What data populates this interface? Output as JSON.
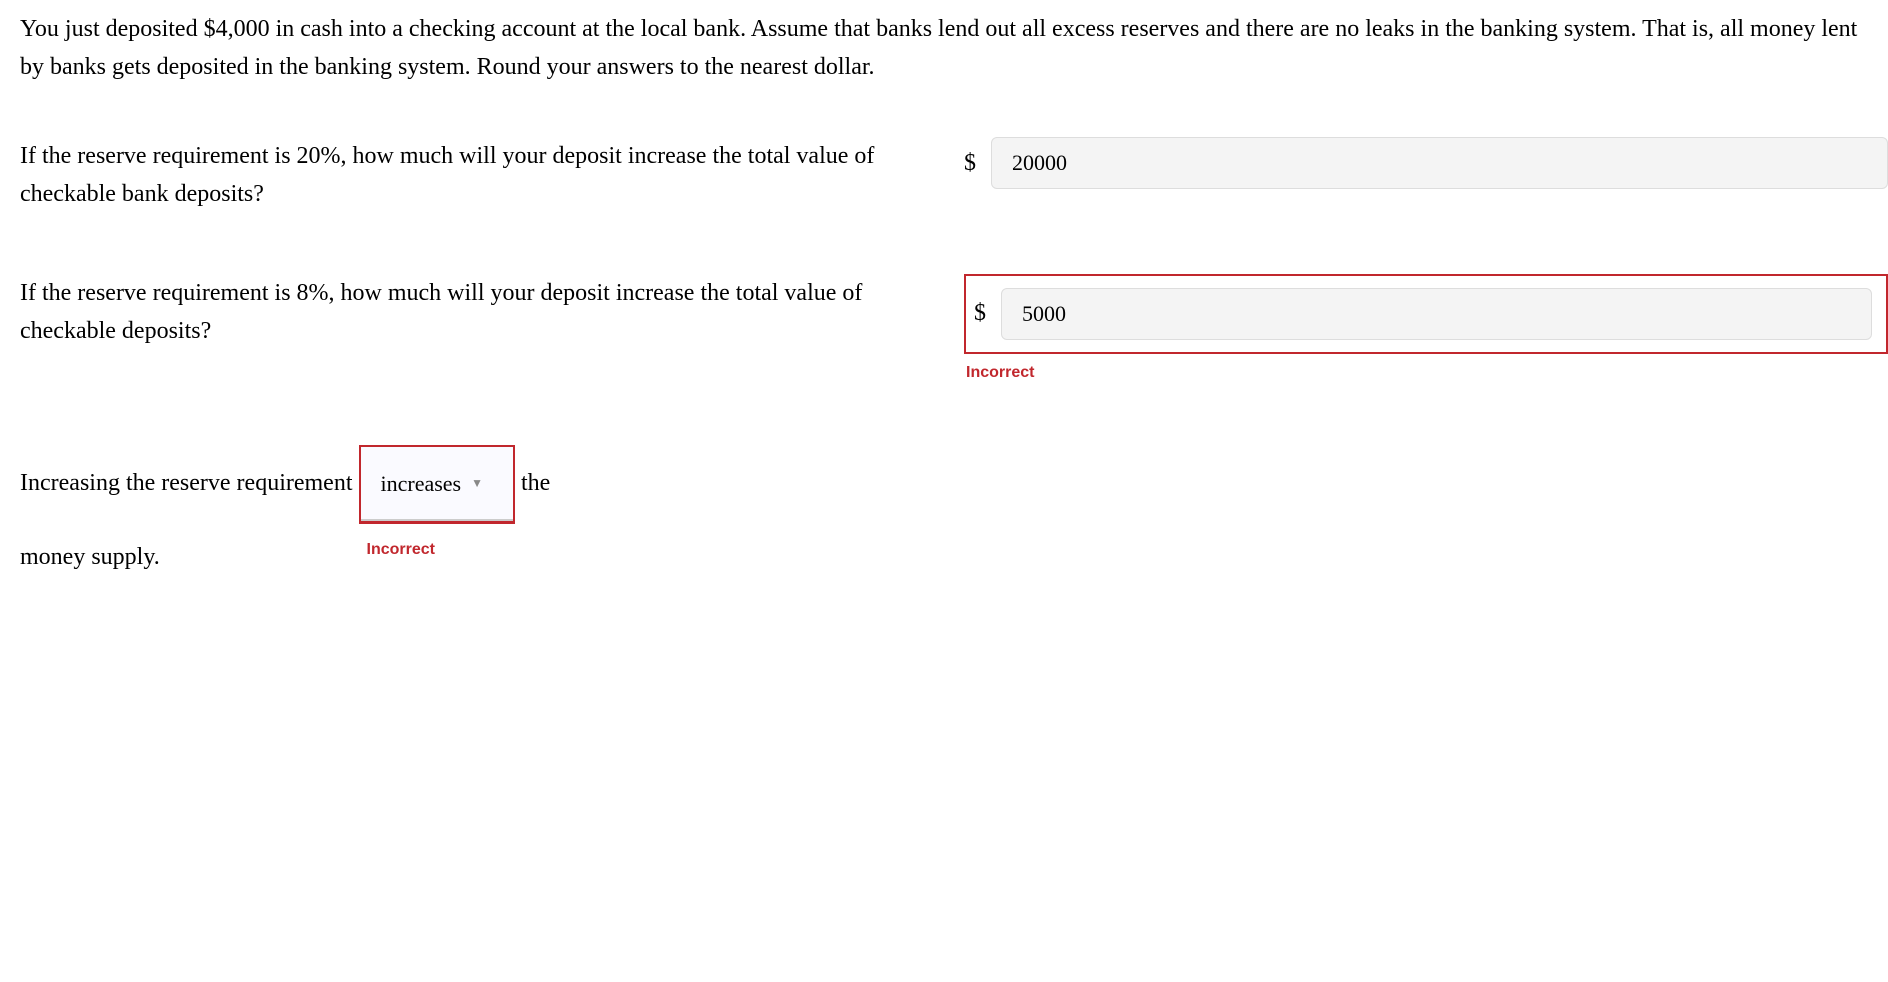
{
  "intro": "You just deposited $4,000 in cash into a checking account at the local bank. Assume that banks lend out all excess reserves and there are no leaks in the banking system. That is, all money lent by banks gets deposited in the banking system. Round your answers to the nearest dollar.",
  "q1": {
    "text": "If the reserve requirement is 20%, how much will your deposit increase the total value of checkable bank deposits?",
    "currency": "$",
    "value": "20000"
  },
  "q2": {
    "text": "If the reserve requirement is 8%, how much will your deposit increase the total value of checkable deposits?",
    "currency": "$",
    "value": "5000",
    "feedback": "Incorrect"
  },
  "q3": {
    "pre": "Increasing the reserve requirement",
    "selected": "increases",
    "mid": "the",
    "post": "money supply.",
    "feedback": "Incorrect"
  }
}
